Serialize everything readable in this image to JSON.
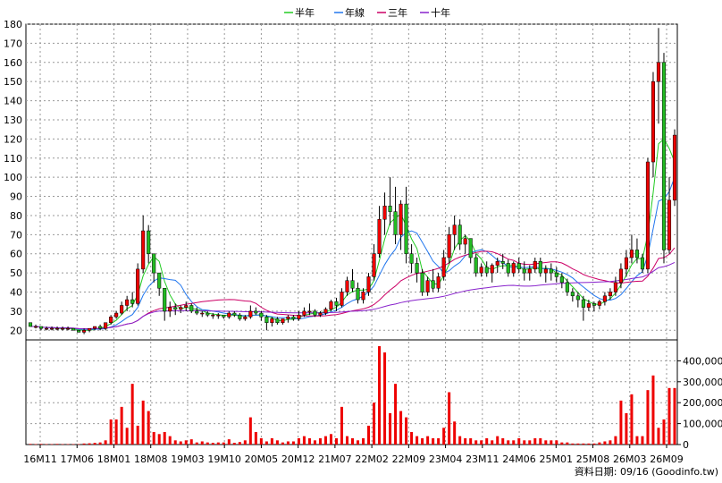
{
  "legend": [
    {
      "label": "半年",
      "color": "#22cc22"
    },
    {
      "label": "年線",
      "color": "#2277ee"
    },
    {
      "label": "三年",
      "color": "#cc0066"
    },
    {
      "label": "十年",
      "color": "#8822cc"
    }
  ],
  "footer": "資料日期: 09/16  (Goodinfo.tw)",
  "chart_data": [
    {
      "type": "candlestick",
      "ylim": [
        15,
        180
      ],
      "yticks": [
        20,
        30,
        40,
        50,
        60,
        70,
        80,
        90,
        100,
        110,
        120,
        130,
        140,
        150,
        160,
        170,
        180
      ],
      "x_labels": [
        "16M11",
        "17M06",
        "18M01",
        "18M08",
        "19M03",
        "19M10",
        "20M05",
        "20M12",
        "21M07",
        "22M02",
        "22M09",
        "23M04",
        "23M11",
        "24M06",
        "25M01",
        "25M08",
        "26M03",
        "26M09"
      ],
      "grid": true,
      "colors": {
        "up": "#ee0000",
        "down": "#22bb22"
      },
      "ohlc": [
        [
          24,
          24,
          22,
          22
        ],
        [
          22,
          23,
          21,
          22
        ],
        [
          22,
          22,
          20,
          21
        ],
        [
          21,
          22,
          20,
          21
        ],
        [
          21,
          22,
          20,
          21
        ],
        [
          21,
          22,
          20,
          21
        ],
        [
          21,
          22,
          20,
          21
        ],
        [
          21,
          22,
          20,
          21
        ],
        [
          21,
          21,
          20,
          20
        ],
        [
          20,
          20,
          19,
          19
        ],
        [
          19,
          21,
          18,
          20
        ],
        [
          20,
          21,
          19,
          21
        ],
        [
          21,
          22,
          20,
          22
        ],
        [
          22,
          23,
          20,
          21
        ],
        [
          21,
          24,
          20,
          24
        ],
        [
          24,
          28,
          23,
          27
        ],
        [
          27,
          30,
          26,
          29
        ],
        [
          29,
          35,
          28,
          33
        ],
        [
          33,
          38,
          30,
          36
        ],
        [
          36,
          40,
          32,
          34
        ],
        [
          34,
          55,
          33,
          52
        ],
        [
          52,
          80,
          50,
          72
        ],
        [
          72,
          75,
          55,
          60
        ],
        [
          60,
          60,
          45,
          50
        ],
        [
          50,
          50,
          38,
          42
        ],
        [
          42,
          42,
          25,
          30
        ],
        [
          30,
          35,
          27,
          32
        ],
        [
          32,
          34,
          28,
          31
        ],
        [
          31,
          33,
          29,
          32
        ],
        [
          32,
          35,
          30,
          33
        ],
        [
          33,
          34,
          29,
          30
        ],
        [
          30,
          32,
          28,
          29
        ],
        [
          29,
          30,
          27,
          29
        ],
        [
          29,
          30,
          27,
          28
        ],
        [
          28,
          29,
          26,
          28
        ],
        [
          28,
          29,
          26,
          28
        ],
        [
          28,
          28,
          26,
          27
        ],
        [
          27,
          30,
          26,
          29
        ],
        [
          29,
          30,
          27,
          28
        ],
        [
          28,
          29,
          25,
          26
        ],
        [
          26,
          28,
          25,
          27
        ],
        [
          27,
          33,
          26,
          30
        ],
        [
          30,
          32,
          28,
          29
        ],
        [
          29,
          30,
          25,
          27
        ],
        [
          27,
          28,
          20,
          24
        ],
        [
          24,
          27,
          22,
          26
        ],
        [
          26,
          27,
          23,
          24
        ],
        [
          24,
          26,
          23,
          26
        ],
        [
          26,
          28,
          24,
          27
        ],
        [
          27,
          28,
          25,
          26
        ],
        [
          26,
          30,
          25,
          28
        ],
        [
          28,
          32,
          27,
          30
        ],
        [
          30,
          34,
          28,
          30
        ],
        [
          30,
          31,
          27,
          28
        ],
        [
          28,
          30,
          27,
          29
        ],
        [
          29,
          32,
          28,
          31
        ],
        [
          31,
          36,
          30,
          35
        ],
        [
          35,
          37,
          30,
          33
        ],
        [
          33,
          42,
          32,
          40
        ],
        [
          40,
          48,
          38,
          46
        ],
        [
          46,
          52,
          40,
          42
        ],
        [
          42,
          45,
          34,
          36
        ],
        [
          36,
          42,
          34,
          40
        ],
        [
          40,
          50,
          38,
          48
        ],
        [
          48,
          65,
          46,
          60
        ],
        [
          60,
          85,
          58,
          78
        ],
        [
          78,
          92,
          70,
          85
        ],
        [
          85,
          100,
          75,
          82
        ],
        [
          82,
          95,
          65,
          70
        ],
        [
          70,
          88,
          62,
          86
        ],
        [
          86,
          95,
          55,
          60
        ],
        [
          60,
          65,
          50,
          55
        ],
        [
          55,
          58,
          45,
          50
        ],
        [
          50,
          52,
          38,
          40
        ],
        [
          40,
          48,
          38,
          46
        ],
        [
          46,
          52,
          40,
          42
        ],
        [
          42,
          50,
          40,
          48
        ],
        [
          48,
          62,
          46,
          58
        ],
        [
          58,
          74,
          55,
          70
        ],
        [
          70,
          80,
          62,
          75
        ],
        [
          75,
          78,
          62,
          65
        ],
        [
          65,
          70,
          60,
          68
        ],
        [
          68,
          68,
          55,
          58
        ],
        [
          58,
          60,
          48,
          50
        ],
        [
          50,
          55,
          48,
          53
        ],
        [
          53,
          56,
          48,
          50
        ],
        [
          50,
          55,
          45,
          54
        ],
        [
          54,
          58,
          50,
          56
        ],
        [
          56,
          60,
          52,
          55
        ],
        [
          55,
          57,
          48,
          50
        ],
        [
          50,
          56,
          48,
          55
        ],
        [
          55,
          58,
          50,
          52
        ],
        [
          52,
          56,
          46,
          50
        ],
        [
          50,
          54,
          46,
          52
        ],
        [
          52,
          58,
          50,
          56
        ],
        [
          56,
          58,
          48,
          50
        ],
        [
          50,
          54,
          45,
          52
        ],
        [
          52,
          55,
          46,
          50
        ],
        [
          50,
          53,
          45,
          48
        ],
        [
          48,
          50,
          42,
          45
        ],
        [
          45,
          47,
          38,
          40
        ],
        [
          40,
          42,
          35,
          38
        ],
        [
          38,
          40,
          32,
          36
        ],
        [
          36,
          38,
          25,
          32
        ],
        [
          32,
          36,
          30,
          34
        ],
        [
          34,
          35,
          30,
          33
        ],
        [
          33,
          36,
          31,
          35
        ],
        [
          35,
          40,
          33,
          38
        ],
        [
          38,
          42,
          36,
          40
        ],
        [
          40,
          48,
          38,
          45
        ],
        [
          45,
          55,
          42,
          52
        ],
        [
          52,
          62,
          48,
          58
        ],
        [
          58,
          70,
          55,
          62
        ],
        [
          62,
          68,
          55,
          58
        ],
        [
          58,
          60,
          50,
          52
        ],
        [
          52,
          110,
          50,
          108
        ],
        [
          108,
          155,
          100,
          150
        ],
        [
          150,
          178,
          128,
          160
        ],
        [
          160,
          165,
          55,
          62
        ],
        [
          62,
          100,
          60,
          88
        ],
        [
          88,
          125,
          85,
          122
        ]
      ],
      "volume": {
        "ylim": [
          0,
          500000
        ],
        "yticks": [
          0,
          100000,
          200000,
          300000,
          400000
        ],
        "ytick_labels": [
          "0",
          "100,000",
          "200,000",
          "300,000",
          "400,000"
        ],
        "values": [
          3000,
          2000,
          3000,
          2000,
          2000,
          3000,
          2000,
          2000,
          2000,
          2000,
          5000,
          6000,
          8000,
          10000,
          20000,
          120000,
          120000,
          180000,
          80000,
          290000,
          90000,
          210000,
          160000,
          60000,
          50000,
          60000,
          40000,
          20000,
          15000,
          20000,
          25000,
          10000,
          15000,
          10000,
          8000,
          10000,
          10000,
          25000,
          8000,
          12000,
          20000,
          130000,
          60000,
          30000,
          15000,
          30000,
          20000,
          10000,
          15000,
          15000,
          30000,
          40000,
          30000,
          20000,
          30000,
          40000,
          50000,
          30000,
          180000,
          40000,
          30000,
          20000,
          30000,
          90000,
          200000,
          470000,
          440000,
          150000,
          290000,
          160000,
          130000,
          60000,
          40000,
          30000,
          40000,
          30000,
          30000,
          80000,
          250000,
          110000,
          40000,
          30000,
          30000,
          20000,
          20000,
          30000,
          20000,
          40000,
          30000,
          20000,
          20000,
          30000,
          20000,
          20000,
          30000,
          30000,
          20000,
          20000,
          20000,
          10000,
          10000,
          5000,
          5000,
          5000,
          5000,
          5000,
          10000,
          15000,
          20000,
          40000,
          210000,
          150000,
          240000,
          40000,
          40000,
          260000,
          330000,
          80000,
          120000,
          270000,
          270000
        ]
      }
    }
  ]
}
